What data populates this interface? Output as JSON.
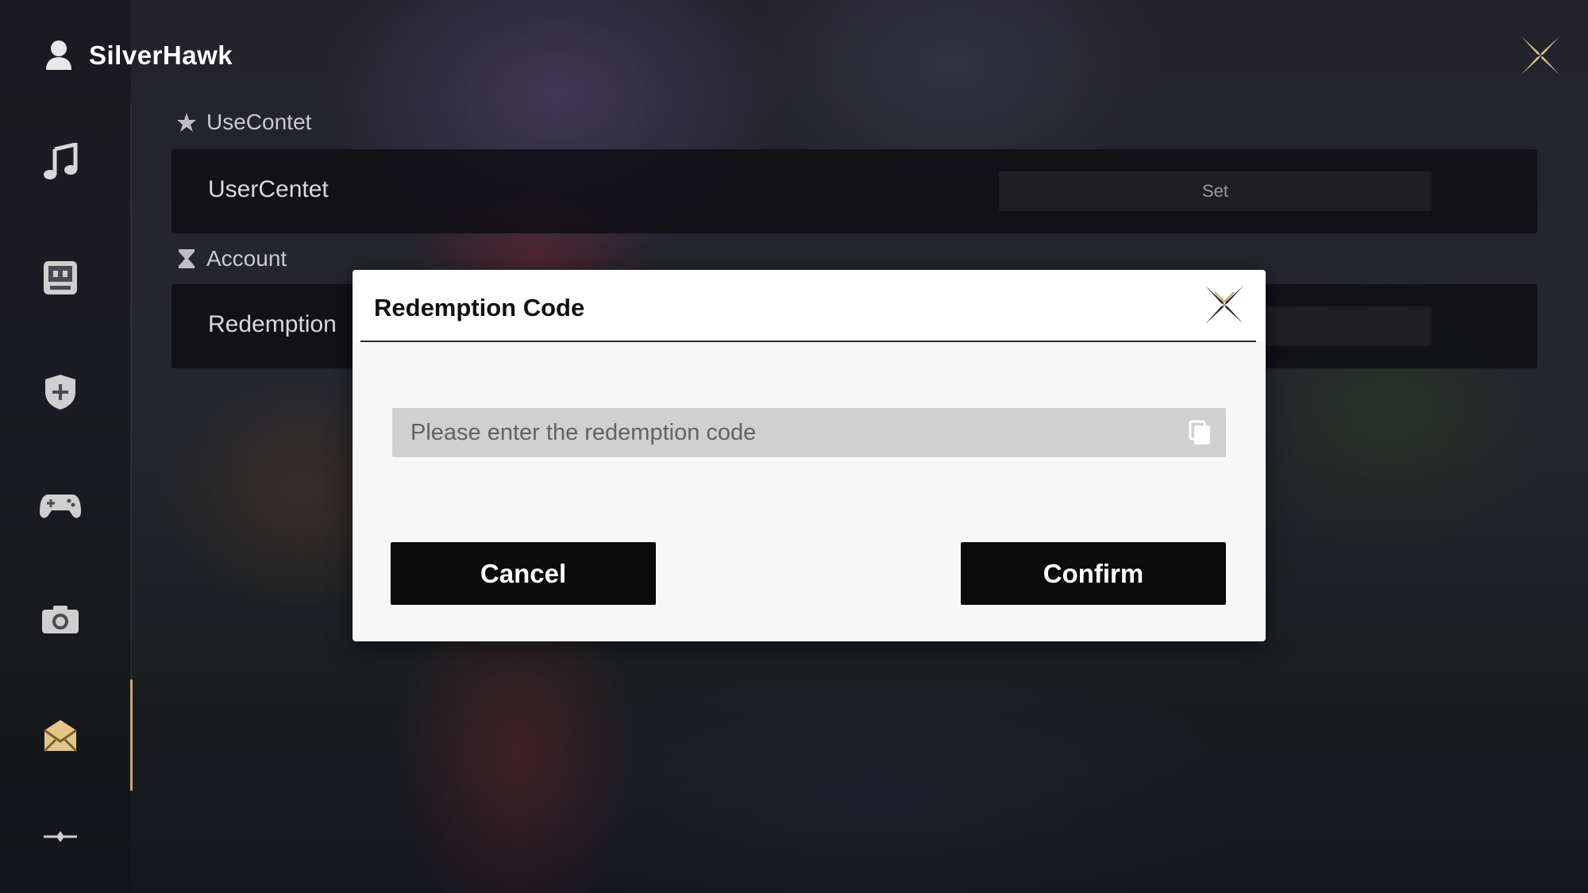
{
  "header": {
    "username": "SilverHawk"
  },
  "sidebar": {
    "items": [
      {
        "icon": "music-note-icon"
      },
      {
        "icon": "display-icon"
      },
      {
        "icon": "shield-icon"
      },
      {
        "icon": "gamepad-icon"
      },
      {
        "icon": "camera-icon"
      },
      {
        "icon": "mail-icon",
        "active": true
      },
      {
        "icon": "more-icon"
      }
    ]
  },
  "settings": {
    "section1_title": "UseContet",
    "row1_label": "UserCentet",
    "row1_button": "Set",
    "section2_title": "Account",
    "row2_label": "Redemption"
  },
  "modal": {
    "title": "Redemption Code",
    "input_placeholder": "Please enter the redemption code",
    "input_value": "",
    "cancel_label": "Cancel",
    "confirm_label": "Confirm"
  },
  "colors": {
    "accent_gold": "#c7a874",
    "button_bg": "#0b0b0b",
    "modal_bg": "#f7f7f7",
    "input_bg": "#d0d0d0"
  }
}
